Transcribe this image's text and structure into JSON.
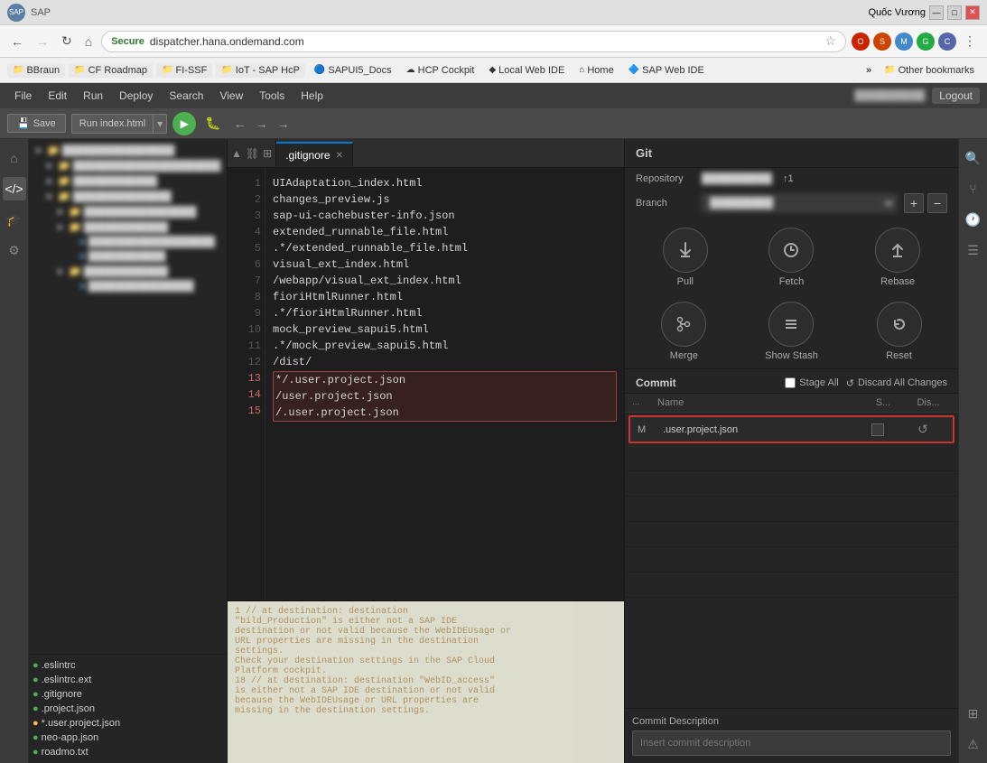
{
  "browser": {
    "titlebar": {
      "title": "SAP",
      "minimize": "—",
      "maximize": "□",
      "close": "✕",
      "user": "Quốc Vương"
    },
    "nav": {
      "back": "←",
      "forward": "→",
      "refresh": "↻",
      "home": "⌂",
      "secure_label": "Secure",
      "address": "dispatcher.hana.ondemand.com"
    },
    "bookmarks": [
      {
        "id": "bbraun",
        "label": "BBraun",
        "type": "folder"
      },
      {
        "id": "cf-roadmap",
        "label": "CF Roadmap",
        "type": "folder"
      },
      {
        "id": "fi-ssf",
        "label": "FI-SSF",
        "type": "folder"
      },
      {
        "id": "iot-sap",
        "label": "IoT - SAP HcP",
        "type": "folder"
      },
      {
        "id": "sapui5-docs",
        "label": "SAPUI5_Docs",
        "type": "link"
      },
      {
        "id": "hcp-cockpit",
        "label": "HCP Cockpit",
        "type": "link"
      },
      {
        "id": "local-web-ide",
        "label": "Local Web IDE",
        "type": "link"
      },
      {
        "id": "home",
        "label": "Home",
        "type": "link"
      },
      {
        "id": "sap-web-ide",
        "label": "SAP Web IDE",
        "type": "link"
      }
    ],
    "bookmarks_more": "»",
    "other_bookmarks": "Other bookmarks"
  },
  "ide": {
    "menu": {
      "items": [
        "File",
        "Edit",
        "Run",
        "Deploy",
        "Search",
        "View",
        "Tools",
        "Help"
      ],
      "user": "██████████",
      "logout": "Logout"
    },
    "toolbar": {
      "save": "Save",
      "run_config": "Run index.html",
      "run": "▶"
    },
    "tabs": [
      {
        "id": "gitignore",
        "label": ".gitignore",
        "active": true
      }
    ],
    "editor": {
      "lines": [
        {
          "num": 1,
          "code": "UIAdaptation_index.html"
        },
        {
          "num": 2,
          "code": "changes_preview.js"
        },
        {
          "num": 3,
          "code": "sap-ui-cachebuster-info.json"
        },
        {
          "num": 4,
          "code": "extended_runnable_file.html"
        },
        {
          "num": 5,
          "code": ".*/extended_runnable_file.html"
        },
        {
          "num": 6,
          "code": "visual_ext_index.html"
        },
        {
          "num": 7,
          "code": "/webapp/visual_ext_index.html"
        },
        {
          "num": 8,
          "code": "fioriHtmlRunner.html"
        },
        {
          "num": 9,
          "code": ".*/fioriHtmlRunner.html"
        },
        {
          "num": 10,
          "code": "mock_preview_sapui5.html"
        },
        {
          "num": 11,
          "code": ".*/mock_preview_sapui5.html"
        },
        {
          "num": 12,
          "code": "/dist/"
        },
        {
          "num": 13,
          "code": "*/.user.project.json",
          "highlighted": true
        },
        {
          "num": 14,
          "code": "/user.project.json",
          "highlighted": true
        },
        {
          "num": 15,
          "code": "/.user.project.json",
          "highlighted": true
        }
      ]
    },
    "file_explorer": {
      "blurred_items": [
        "item1",
        "item2",
        "item3",
        "item4",
        "item5",
        "item6"
      ],
      "bottom_files": [
        {
          "id": "eslintrc",
          "label": ".eslintrc",
          "dot": "green"
        },
        {
          "id": "eslintrc-ext",
          "label": ".eslintrc.ext",
          "dot": "green"
        },
        {
          "id": "gitignore-file",
          "label": ".gitignore",
          "dot": "green"
        },
        {
          "id": "project-json",
          "label": ".project.json",
          "dot": "green"
        },
        {
          "id": "user-project",
          "label": "*.user.project.json",
          "dot": "yellow"
        },
        {
          "id": "neo-app",
          "label": "neo-app.json",
          "dot": "green"
        },
        {
          "id": "readme",
          "label": "roadmo.txt",
          "dot": "green"
        }
      ]
    },
    "git": {
      "title": "Git",
      "repository_label": "Repository",
      "repository_value": "██████████",
      "repository_count": "↑1",
      "branch_label": "Branch",
      "branch_value": "█████████",
      "actions_row1": [
        {
          "id": "pull",
          "icon": "⬇",
          "label": "Pull"
        },
        {
          "id": "fetch",
          "icon": "⟳",
          "label": "Fetch"
        },
        {
          "id": "rebase",
          "icon": "⬆",
          "label": "Rebase"
        }
      ],
      "actions_row2": [
        {
          "id": "merge",
          "icon": "⑂",
          "label": "Merge"
        },
        {
          "id": "show-stash",
          "icon": "☰",
          "label": "Show Stash"
        },
        {
          "id": "reset",
          "icon": "↺",
          "label": "Reset"
        }
      ],
      "commit_label": "Commit",
      "stage_all": "Stage All",
      "discard_all": "Discard All Changes",
      "table_headers": {
        "dots": "...",
        "name": "Name",
        "stage": "S...",
        "discard": "Dis..."
      },
      "changed_files": [
        {
          "id": "user-project-json",
          "status": "M",
          "name": ".user.project.json",
          "staged": false
        }
      ],
      "commit_description_label": "Commit Description",
      "commit_description_placeholder": "Insert commit description"
    },
    "bottom_panel": {
      "lines": [
        "1  // at destination: destination",
        "\"bild_Production\" is either not a SAP IDE",
        "destination or not valid because the WebIDEUsage or",
        "URL properties are missing in the destination",
        "settings.",
        "Check your destination settings in the SAP Cloud",
        "Platform cockpit.",
        "18  // at destination: destination \"WebID_access\"",
        "is either not a SAP IDE destination or not valid",
        "because the WebIDEUsage or URL properties are",
        "missing in the destination settings."
      ]
    }
  }
}
